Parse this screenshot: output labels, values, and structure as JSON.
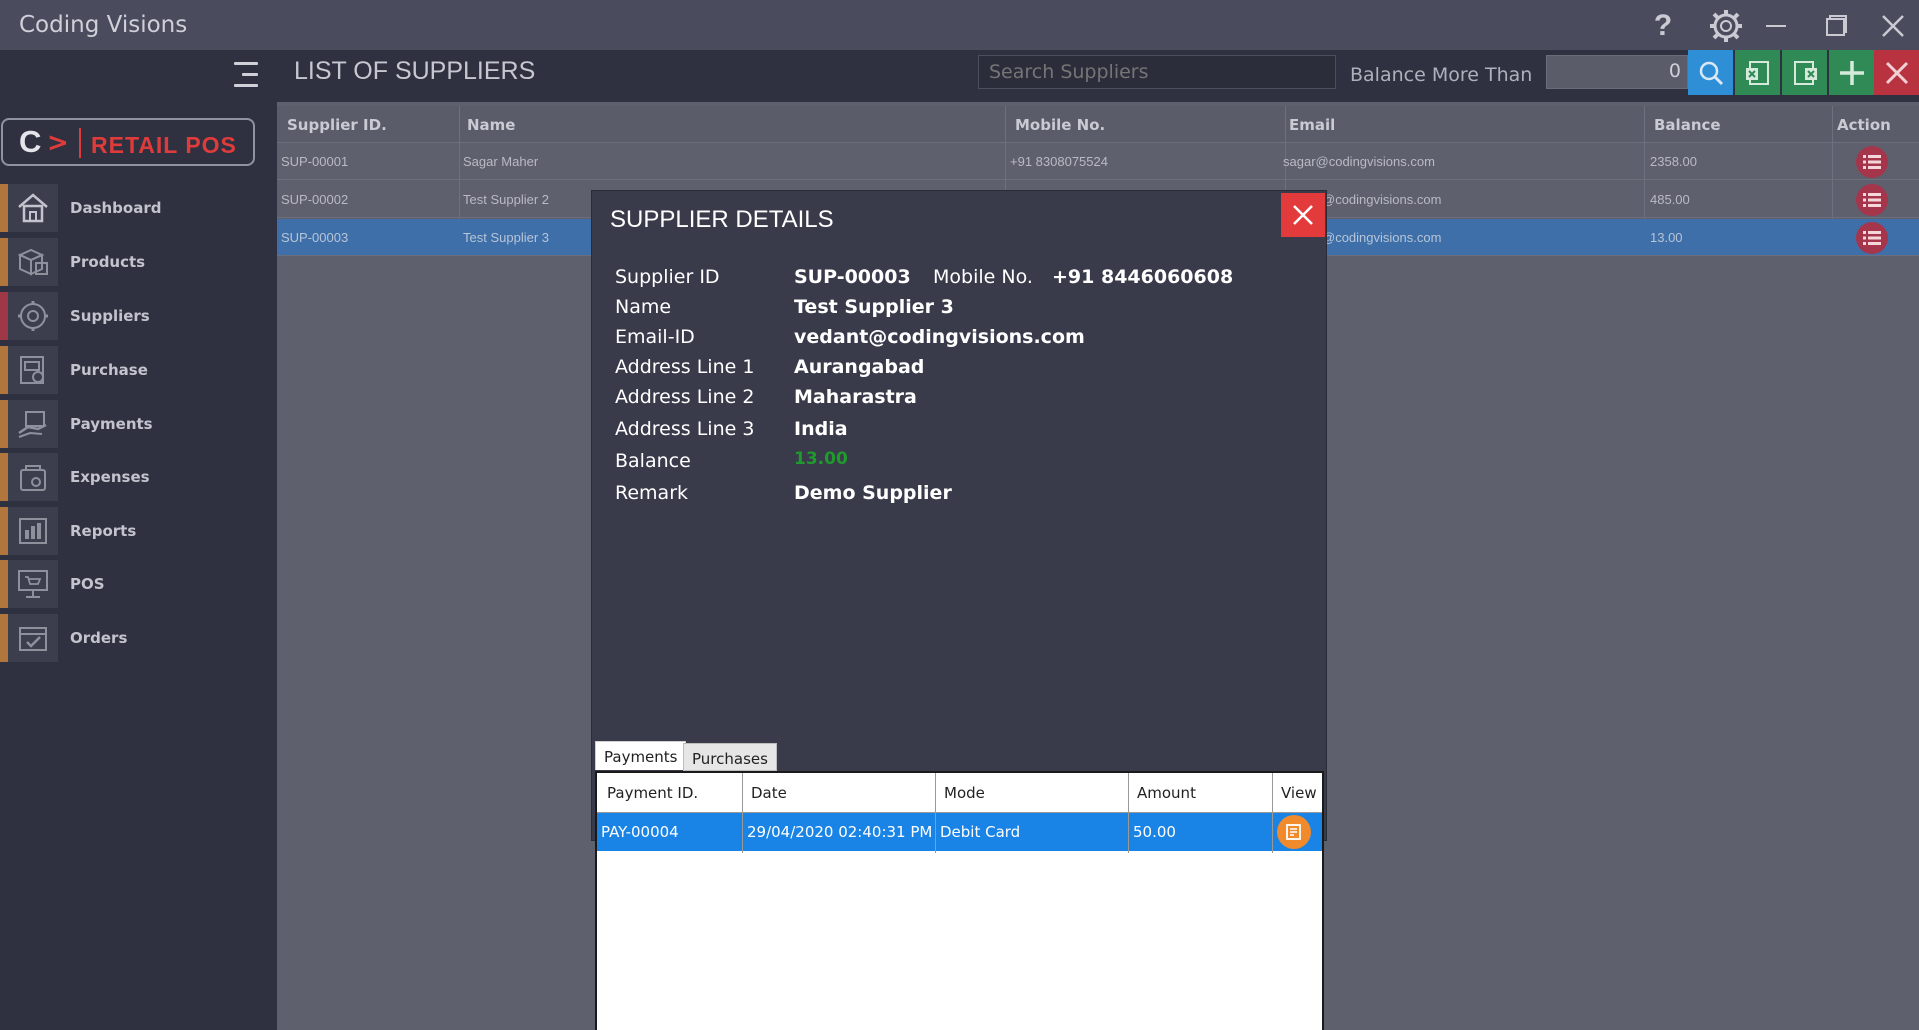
{
  "window": {
    "title": "Coding Visions"
  },
  "sidebar": {
    "logo": {
      "letter": "C",
      "text": "RETAIL POS"
    },
    "items": [
      {
        "label": "Dashboard",
        "icon": "home-icon"
      },
      {
        "label": "Products",
        "icon": "boxes-icon"
      },
      {
        "label": "Suppliers",
        "icon": "suppliers-icon"
      },
      {
        "label": "Purchase",
        "icon": "purchase-icon"
      },
      {
        "label": "Payments",
        "icon": "payments-icon"
      },
      {
        "label": "Expenses",
        "icon": "wallet-icon"
      },
      {
        "label": "Reports",
        "icon": "reports-icon"
      },
      {
        "label": "POS",
        "icon": "pos-icon"
      },
      {
        "label": "Orders",
        "icon": "orders-icon"
      }
    ]
  },
  "header": {
    "title": "LIST OF SUPPLIERS",
    "search_placeholder": "Search Suppliers",
    "balance_label": "Balance More Than",
    "balance_value": "0"
  },
  "table": {
    "columns": [
      "Supplier ID.",
      "Name",
      "Mobile No.",
      "Email",
      "Balance",
      "Action"
    ],
    "rows": [
      {
        "id": "SUP-00001",
        "name": "Sagar Maher",
        "mobile": "+91 8308075524",
        "email": "sagar@codingvisions.com",
        "balance": "2358.00"
      },
      {
        "id": "SUP-00002",
        "name": "Test Supplier 2",
        "mobile": "",
        "email": "@codingvisions.com",
        "balance": "485.00"
      },
      {
        "id": "SUP-00003",
        "name": "Test Supplier 3",
        "mobile": "",
        "email": "@codingvisions.com",
        "balance": "13.00"
      }
    ]
  },
  "modal": {
    "title": "SUPPLIER DETAILS",
    "labels": {
      "supplier_id": "Supplier ID",
      "mobile": "Mobile No.",
      "name": "Name",
      "email": "Email-ID",
      "addr1": "Address Line 1",
      "addr2": "Address Line 2",
      "addr3": "Address Line 3",
      "balance": "Balance",
      "remark": "Remark"
    },
    "values": {
      "supplier_id": "SUP-00003",
      "mobile": "+91 8446060608",
      "name": "Test Supplier 3",
      "email": "vedant@codingvisions.com",
      "addr1": "Aurangabad",
      "addr2": "Maharastra",
      "addr3": "India",
      "balance": "13.00",
      "remark": "Demo Supplier"
    },
    "tabs": [
      "Payments",
      "Purchases"
    ],
    "grid": {
      "columns": [
        "Payment ID.",
        "Date",
        "Mode",
        "Amount",
        "View"
      ],
      "rows": [
        {
          "id": "PAY-00004",
          "date": "29/04/2020 02:40:31 PM",
          "mode": "Debit Card",
          "amount": "50.00"
        }
      ]
    }
  },
  "colors": {
    "accent_red": "#e33b3b",
    "selected_blue": "#1a84e6",
    "balance_green": "#1f9a2c"
  }
}
